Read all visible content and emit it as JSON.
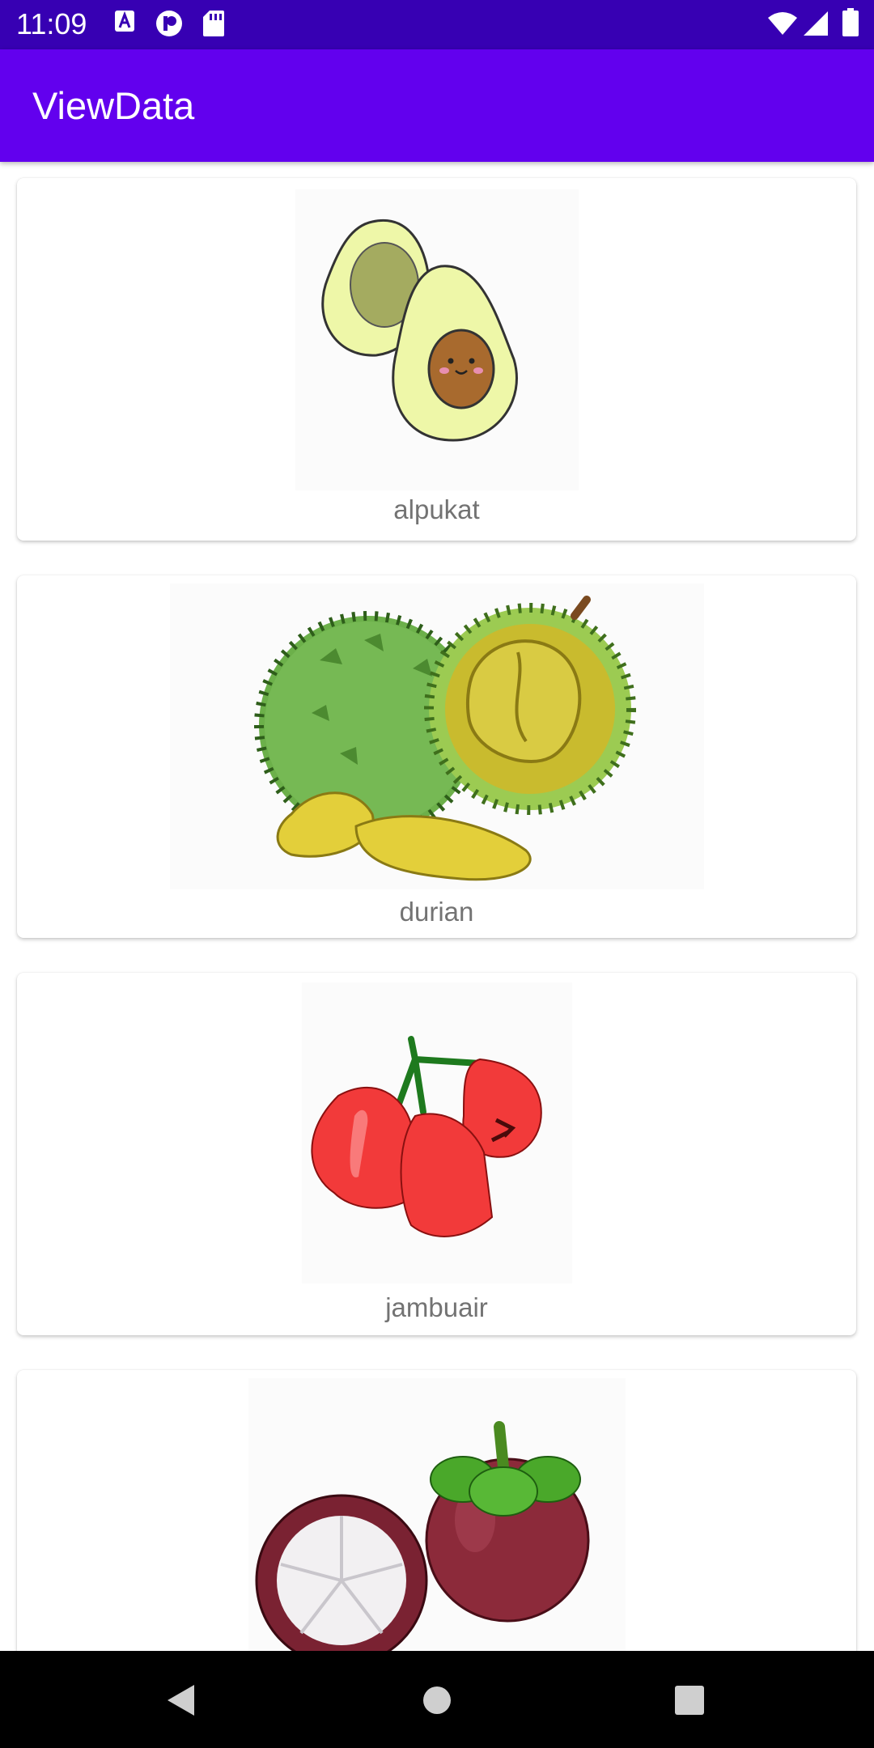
{
  "status_bar": {
    "time": "11:09",
    "icons": [
      "a-icon",
      "p-icon",
      "sd-card-icon",
      "wifi-icon",
      "signal-icon",
      "battery-icon"
    ]
  },
  "app_bar": {
    "title": "ViewData"
  },
  "items": [
    {
      "label": "alpukat",
      "image": "avocado-image"
    },
    {
      "label": "durian",
      "image": "durian-image"
    },
    {
      "label": "jambuair",
      "image": "water-apple-image"
    },
    {
      "label": "",
      "image": "mangosteen-image"
    }
  ],
  "nav_bar": {
    "buttons": [
      "back-icon",
      "home-icon",
      "recents-icon"
    ]
  },
  "colors": {
    "status_bar": "#3700b3",
    "app_bar": "#6200ee",
    "label_text": "#737373",
    "nav_bar": "#000000"
  }
}
